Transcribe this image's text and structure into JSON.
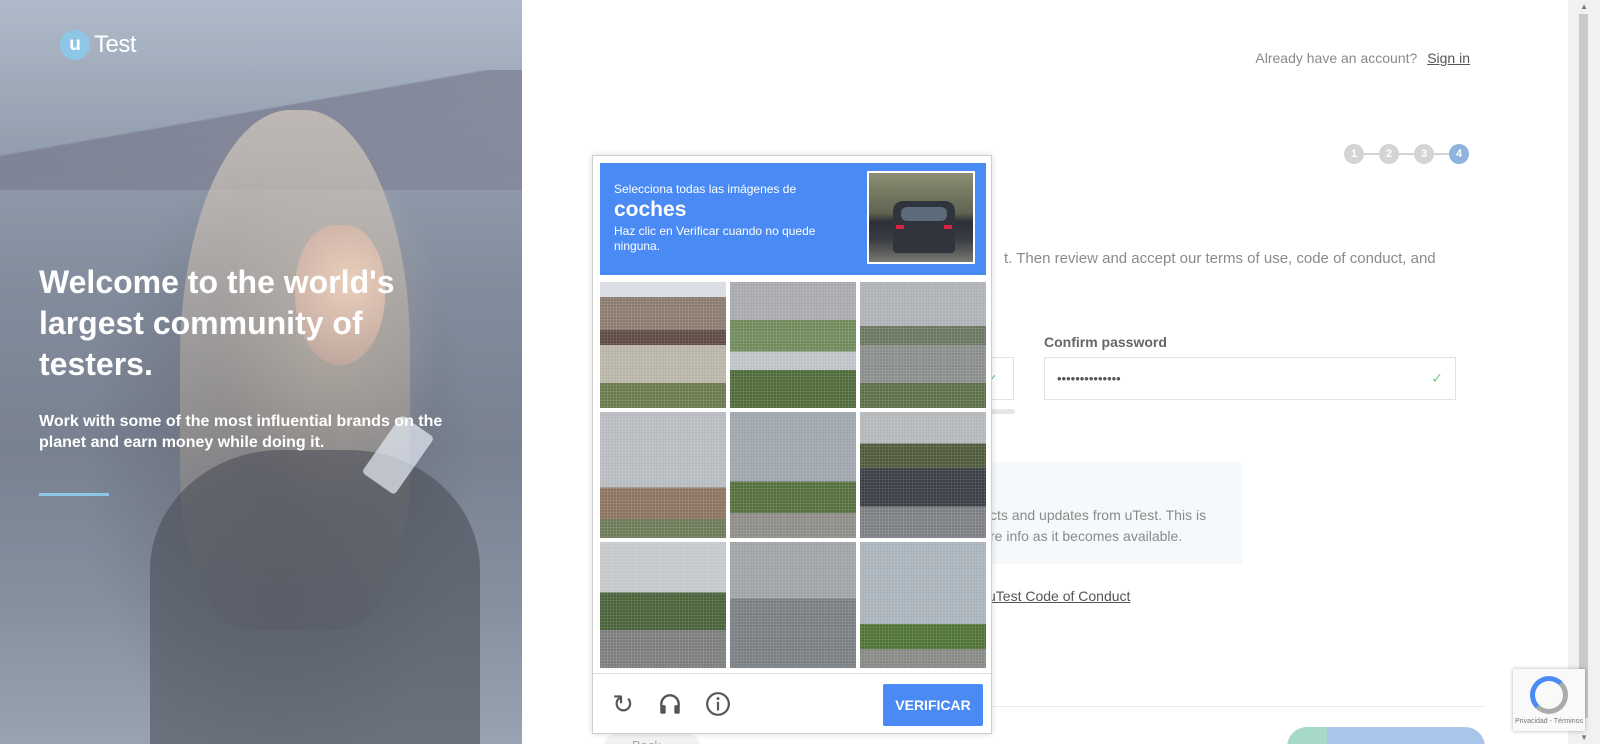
{
  "hero": {
    "logo_mark": "u",
    "logo_text": "Test",
    "title": "Welcome to the world's largest community of testers.",
    "subtitle": "Work with some of the most influential brands on the planet and earn money while doing it."
  },
  "header": {
    "signin_prompt": "Already have an account?",
    "signin_link": "Sign in"
  },
  "stepper": {
    "steps": [
      "1",
      "2",
      "3",
      "4"
    ],
    "active_step": 4
  },
  "form": {
    "intro_text": "t. Then review and accept our terms of use, code of conduct, and",
    "confirm_password_label": "Confirm password",
    "confirm_password_value": "••••••••••••••",
    "info_line_1": "cts and updates from uTest. This is",
    "info_line_2": "re info as it becomes available.",
    "code_of_conduct_link": "uTest Code of Conduct",
    "back_label": "Back"
  },
  "captcha": {
    "prompt": "Selecciona todas las imágenes de",
    "target": "coches",
    "hint": "Haz clic en Verificar cuando no quede ninguna.",
    "verify_label": "VERIFICAR",
    "tiles": [
      {
        "name": "captcha-tile-1"
      },
      {
        "name": "captcha-tile-2"
      },
      {
        "name": "captcha-tile-3"
      },
      {
        "name": "captcha-tile-4"
      },
      {
        "name": "captcha-tile-5"
      },
      {
        "name": "captcha-tile-6"
      },
      {
        "name": "captcha-tile-7"
      },
      {
        "name": "captcha-tile-8"
      },
      {
        "name": "captcha-tile-9"
      }
    ],
    "icons": [
      "reload-icon",
      "headphones-icon",
      "info-icon"
    ]
  },
  "recaptcha_badge": {
    "privacy": "Privacidad - Términos"
  },
  "colors": {
    "captcha_blue": "#4a8af4",
    "accent_light_blue": "#8ec6e6",
    "step_active": "#8eb4dd",
    "check_green": "#79c98d"
  }
}
